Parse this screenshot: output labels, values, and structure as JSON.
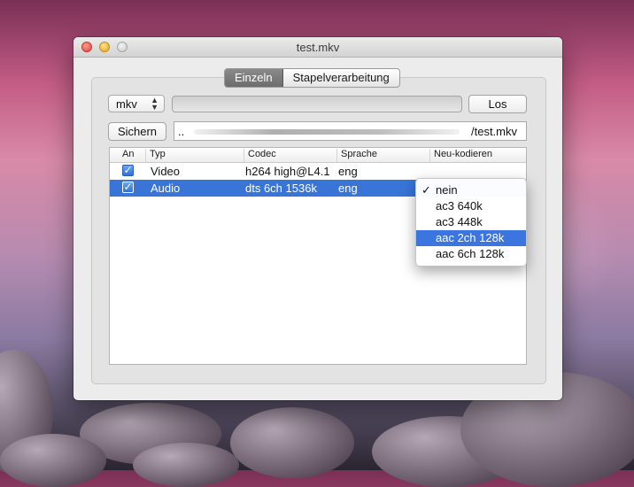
{
  "window": {
    "title": "test.mkv"
  },
  "tabs": [
    {
      "label": "Einzeln",
      "active": true
    },
    {
      "label": "Stapelverarbeitung",
      "active": false
    }
  ],
  "format_popup": {
    "value": "mkv"
  },
  "buttons": {
    "go": "Los",
    "save": "Sichern"
  },
  "output_path": {
    "prefix": "..",
    "suffix": "/test.mkv"
  },
  "table": {
    "columns": [
      "An",
      "Typ",
      "Codec",
      "Sprache",
      "Neu-kodieren"
    ],
    "rows": [
      {
        "enabled": true,
        "type": "Video",
        "codec": "h264 high@L4.1",
        "language": "eng",
        "selected": false
      },
      {
        "enabled": true,
        "type": "Audio",
        "codec": "dts 6ch 1536k",
        "language": "eng",
        "selected": true
      }
    ]
  },
  "reencode_menu": {
    "items": [
      "nein",
      "ac3 640k",
      "ac3 448k",
      "aac 2ch 128k",
      "aac 6ch 128k"
    ],
    "checked_item": "nein",
    "highlighted_item": "aac 2ch 128k",
    "check_glyph": "✓"
  },
  "colors": {
    "selection": "#3875d7",
    "menu_highlight": "#3b76e0"
  }
}
